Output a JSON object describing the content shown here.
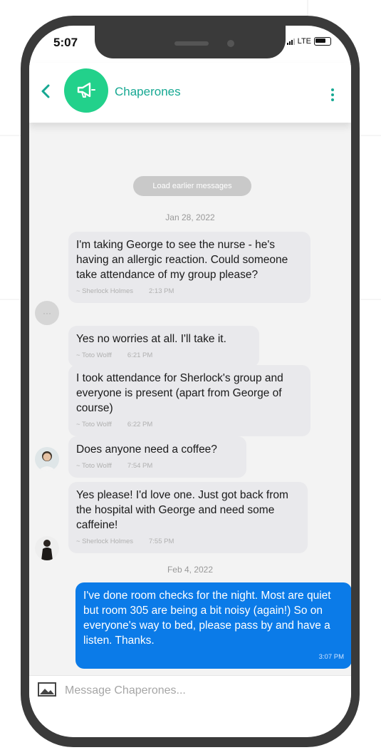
{
  "status_bar": {
    "time": "5:07",
    "carrier": "LTE"
  },
  "header": {
    "back_icon": "chevron-left-icon",
    "group_icon": "megaphone-icon",
    "title": "Chaperones",
    "menu_icon": "vertical-dots-icon"
  },
  "chat": {
    "load_earlier_label": "Load earlier messages",
    "dates": [
      "Jan 28, 2022",
      "Feb 4, 2022"
    ],
    "messages": [
      {
        "text": "I'm taking George to see the nurse - he's having an allergic reaction. Could someone take attendance of my group please?",
        "sender": "~ Sherlock Holmes",
        "time": "2:13 PM"
      },
      {
        "text": "Yes no worries at all. I'll take it.",
        "sender": "~ Toto Wolff",
        "time": "6:21 PM"
      },
      {
        "text": "I took attendance for Sherlock's group and everyone is present (apart from George of course)",
        "sender": "~ Toto Wolff",
        "time": "6:22 PM"
      },
      {
        "text": "Does anyone need a coffee?",
        "sender": "~ Toto Wolff",
        "time": "7:54 PM"
      },
      {
        "text": "Yes please! I'd love one. Just got back from the hospital with George and need some caffeine!",
        "sender": "~ Sherlock Holmes",
        "time": "7:55 PM"
      },
      {
        "text": "I've done room checks for the night. Most are quiet but room 305 are being a bit noisy (again!) So on everyone's way to bed, please pass by and have a listen. Thanks.",
        "time": "3:07 PM"
      }
    ]
  },
  "composer": {
    "attach_icon": "image-icon",
    "placeholder": "Message Chaperones..."
  },
  "colors": {
    "brand_green": "#22d18b",
    "title_teal": "#16a892",
    "own_bubble_blue": "#0b7be8",
    "received_bubble": "#e9e9ec",
    "phone_frame": "#3a3a3a"
  }
}
